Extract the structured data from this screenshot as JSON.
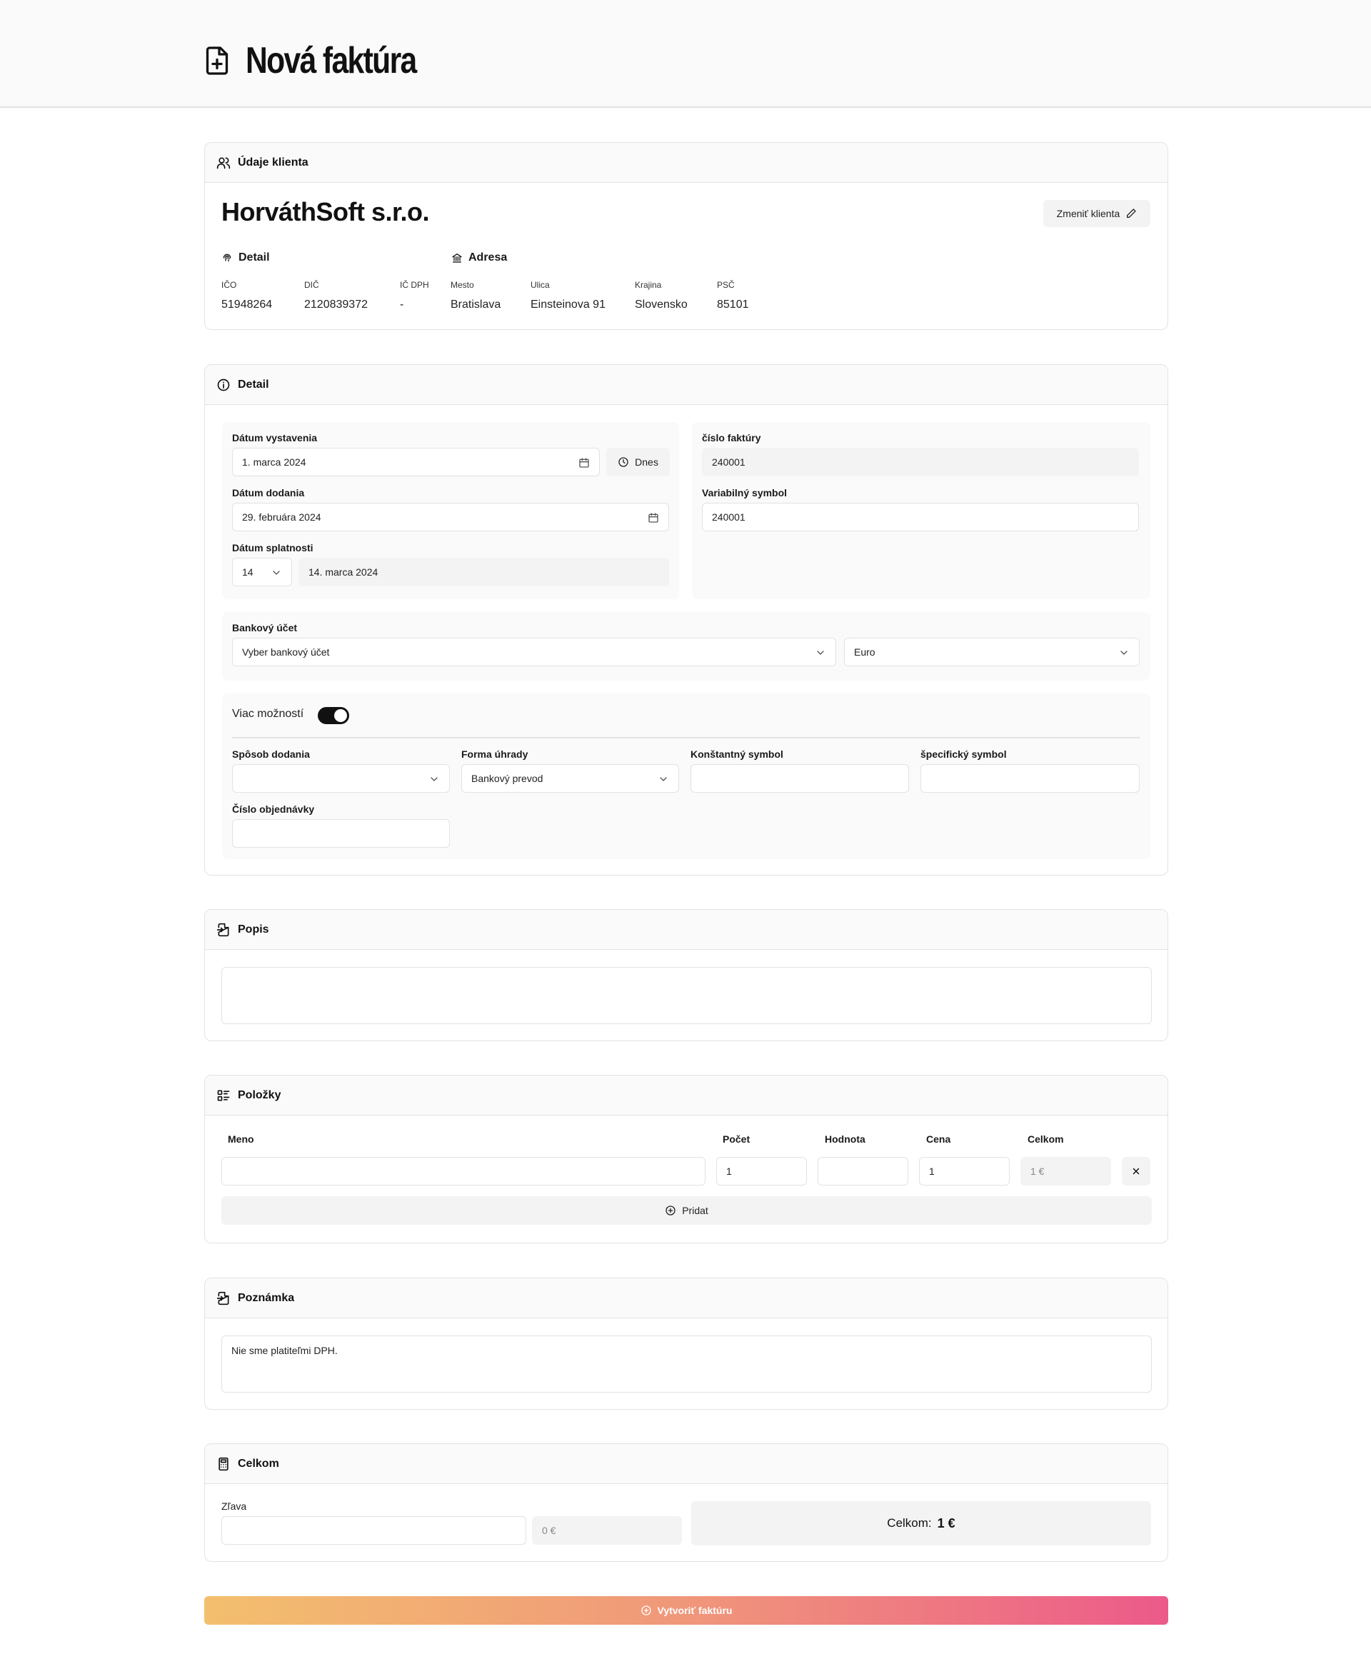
{
  "header": {
    "title": "Nová faktúra"
  },
  "client_card": {
    "title": "Údaje klienta",
    "client_name": "HorváthSoft s.r.o.",
    "change_button": "Zmeniť klienta",
    "detail_heading": "Detail",
    "address_heading": "Adresa",
    "fields": [
      {
        "label": "IČO",
        "value": "51948264"
      },
      {
        "label": "DIČ",
        "value": "2120839372"
      },
      {
        "label": "IČ DPH",
        "value": "-"
      },
      {
        "label": "Mesto",
        "value": "Bratislava"
      },
      {
        "label": "Ulica",
        "value": "Einsteinova 91"
      },
      {
        "label": "Krajina",
        "value": "Slovensko"
      },
      {
        "label": "PSČ",
        "value": "85101"
      }
    ]
  },
  "detail_card": {
    "title": "Detail",
    "issue_date_label": "Dátum vystavenia",
    "issue_date_value": "1. marca 2024",
    "today_button": "Dnes",
    "delivery_date_label": "Dátum dodania",
    "delivery_date_value": "29. februára 2024",
    "due_date_label": "Dátum splatnosti",
    "due_days_value": "14",
    "due_date_value": "14. marca 2024",
    "invoice_number_label": "číslo faktúry",
    "invoice_number_value": "240001",
    "variable_symbol_label": "Variabilný symbol",
    "variable_symbol_value": "240001",
    "bank_account_label": "Bankový účet",
    "bank_account_placeholder": "Vyber bankový účet",
    "currency_value": "Euro",
    "more_options_label": "Viac možností",
    "more_options_on": true,
    "delivery_method_label": "Spôsob dodania",
    "delivery_method_value": "",
    "payment_form_label": "Forma úhrady",
    "payment_form_value": "Bankový prevod",
    "constant_symbol_label": "Konštantný symbol",
    "specific_symbol_label": "špecifický symbol",
    "order_number_label": "Číslo objednávky"
  },
  "description_card": {
    "title": "Popis",
    "value": ""
  },
  "items_card": {
    "title": "Položky",
    "columns": [
      "Meno",
      "Počet",
      "Hodnota",
      "Cena",
      "Celkom"
    ],
    "rows": [
      {
        "name": "",
        "count": "1",
        "unit": "",
        "price": "1",
        "total": "1 €"
      }
    ],
    "add_button": "Pridat"
  },
  "note_card": {
    "title": "Poznámka",
    "value": "Nie sme platiteľmi DPH."
  },
  "total_card": {
    "title": "Celkom",
    "discount_label": "Zľava",
    "discount_value": "",
    "discount_amount": "0 €",
    "total_label": "Celkom:",
    "total_value": "1 €"
  },
  "create_button": "Vytvoriť faktúru"
}
